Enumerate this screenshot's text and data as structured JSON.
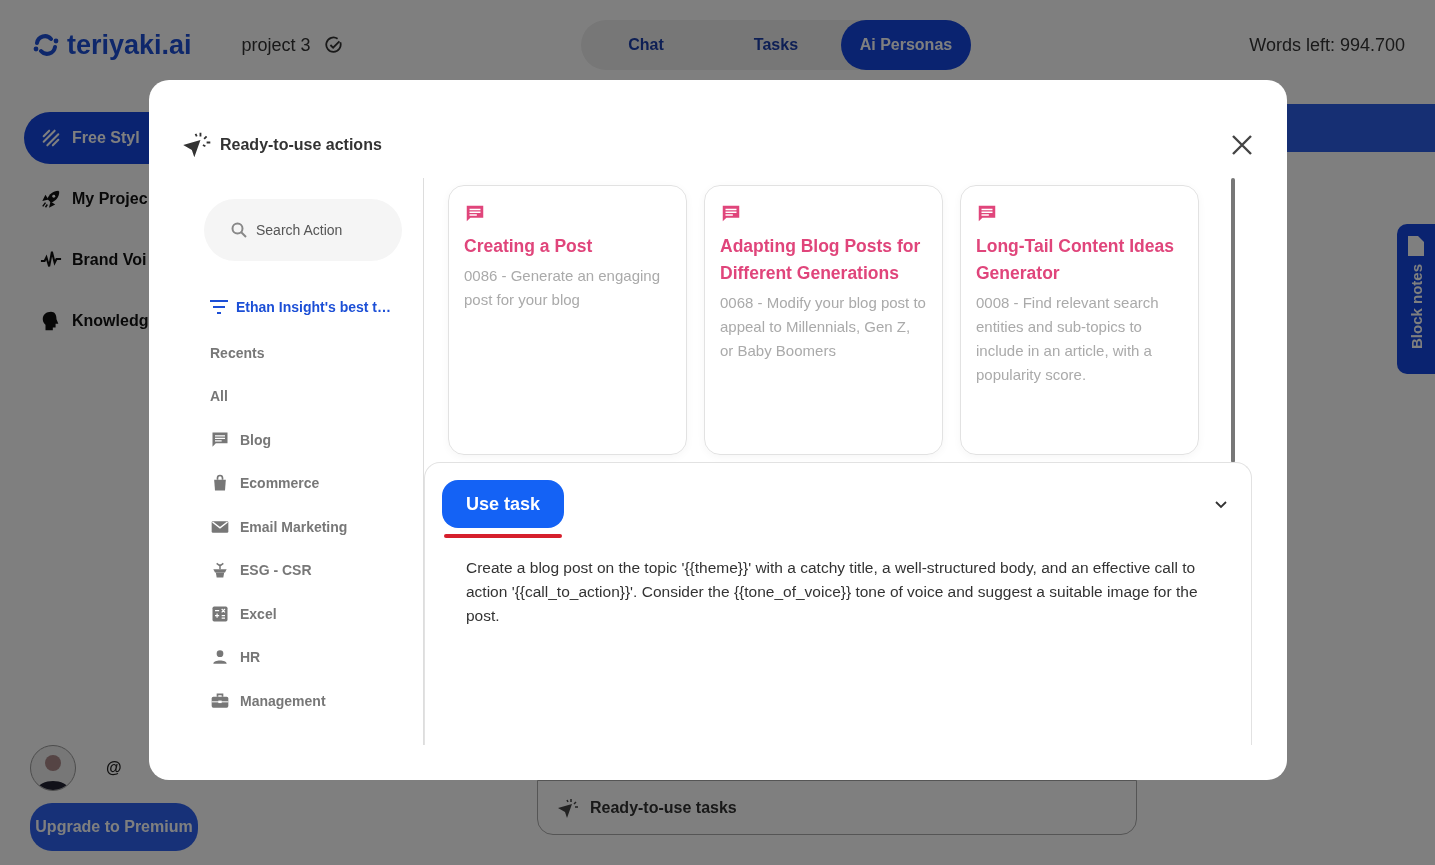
{
  "header": {
    "logo": "teriyaki.ai",
    "project": "project 3",
    "tabs": [
      {
        "label": "Chat",
        "selected": false
      },
      {
        "label": "Tasks",
        "selected": false
      },
      {
        "label": "Ai Personas",
        "selected": true
      }
    ],
    "words_left": "Words left: 994.700"
  },
  "sidebar": {
    "items": [
      {
        "label": "Free Styl",
        "selected": true
      },
      {
        "label": "My Projec",
        "selected": false
      },
      {
        "label": "Brand Voi",
        "selected": false
      },
      {
        "label": "Knowledg",
        "selected": false
      }
    ],
    "handle": "@",
    "upgrade_button": "Upgrade to Premium"
  },
  "block_notes": "Block notes",
  "tasks_bar": "Ready-to-use tasks",
  "modal": {
    "title": "Ready-to-use actions",
    "search": {
      "placeholder": "Search Action"
    },
    "filter": "Ethan Insight's best t…",
    "categories": [
      {
        "label": "Recents",
        "kind": "heading"
      },
      {
        "label": "All",
        "kind": "heading"
      },
      {
        "label": "Blog",
        "kind": "category"
      },
      {
        "label": "Ecommerce",
        "kind": "category"
      },
      {
        "label": "Email Marketing",
        "kind": "category"
      },
      {
        "label": "ESG - CSR",
        "kind": "category"
      },
      {
        "label": "Excel",
        "kind": "category"
      },
      {
        "label": "HR",
        "kind": "category"
      },
      {
        "label": "Management",
        "kind": "category"
      }
    ],
    "cards": [
      {
        "title": "Creating a Post",
        "description": "0086 - Generate an engaging post for your blog"
      },
      {
        "title": "Adapting Blog Posts for Different Generations",
        "description": "0068 - Modify your blog post to appeal to Millennials, Gen Z, or Baby Boomers"
      },
      {
        "title": "Long-Tail Content Ideas Generator",
        "description": "0008 - Find relevant search entities and sub-topics to include in an article, with a popularity score."
      }
    ],
    "detail": {
      "button": "Use task",
      "prompt": "Create a blog post on the topic '{{theme}}' with a catchy title, a well-structured body, and an effective call to action '{{call_to_action}}'. Consider the {{tone_of_voice}} tone of voice and suggest a suitable image for the post."
    }
  }
}
